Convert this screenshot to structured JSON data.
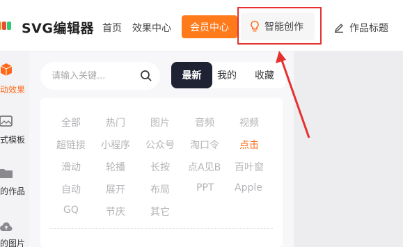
{
  "header": {
    "brand": "SVG编辑器",
    "nav": {
      "home": "首页",
      "effects": "效果中心",
      "member": "会员中心",
      "ai_create": "智能创作",
      "work_title": "作品标题"
    }
  },
  "sidebar": {
    "items": [
      {
        "label": "动效果",
        "icon": "cube-icon",
        "active": true
      },
      {
        "label": "式模板",
        "icon": "image-frame-icon",
        "active": false
      },
      {
        "label": "的作品",
        "icon": "folder-icon",
        "active": false
      },
      {
        "label": "的图片",
        "icon": "cloud-upload-icon",
        "active": false
      }
    ]
  },
  "search": {
    "placeholder": "请输入关键..."
  },
  "segments": [
    "最新",
    "我的",
    "收藏"
  ],
  "tags": [
    [
      "全部",
      "热门",
      "图片",
      "音频",
      "视频"
    ],
    [
      "超链接",
      "小程序",
      "公众号",
      "淘口令",
      "点击"
    ],
    [
      "滑动",
      "轮播",
      "长按",
      "点A见B",
      "百叶窗"
    ],
    [
      "自动",
      "展开",
      "布局",
      "PPT",
      "Apple"
    ],
    [
      "GQ",
      "节庆",
      "其它"
    ]
  ],
  "colors": {
    "accent": "#ff7a1a",
    "highlight_box": "#e53030",
    "segment_active": "#1f2233"
  }
}
